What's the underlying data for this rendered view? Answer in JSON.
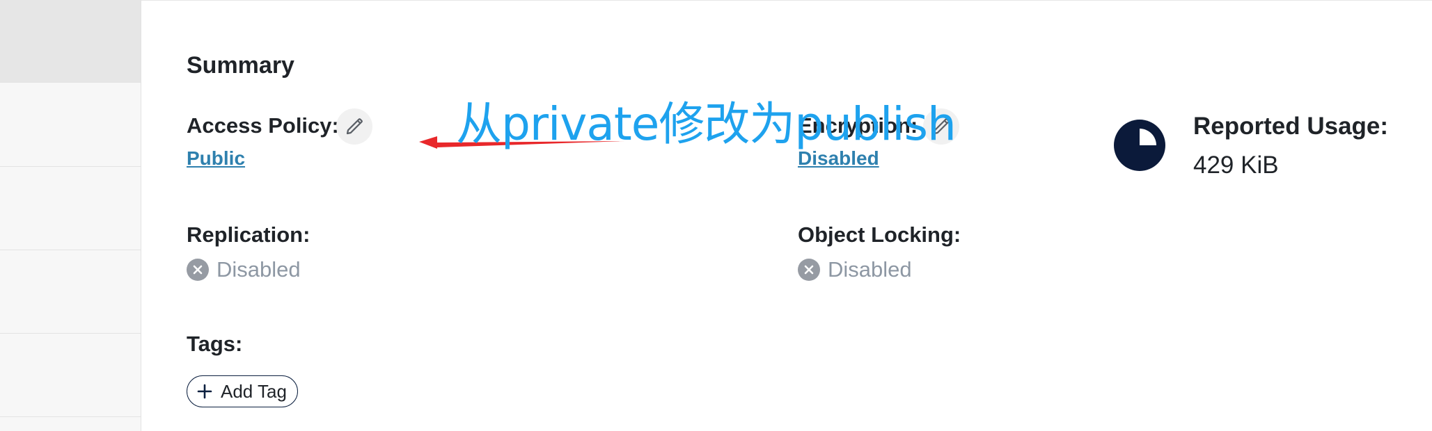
{
  "summary": {
    "title": "Summary",
    "access_policy": {
      "label": "Access Policy:",
      "value": "Public",
      "edit_icon": "pencil-icon"
    },
    "encryption": {
      "label": "Encryption:",
      "value": "Disabled",
      "edit_icon": "pencil-icon"
    },
    "reported_usage": {
      "label": "Reported Usage:",
      "value": "429 KiB",
      "icon": "pie-usage-icon"
    },
    "replication": {
      "label": "Replication:",
      "value": "Disabled",
      "icon": "x-circle-icon"
    },
    "object_locking": {
      "label": "Object Locking:",
      "value": "Disabled",
      "icon": "x-circle-icon"
    },
    "tags": {
      "label": "Tags:",
      "add_button_label": "Add Tag",
      "add_icon": "plus-icon"
    }
  },
  "annotation": {
    "text": "从private修改为publish",
    "color": "#1ea2ee",
    "arrow_color": "#e8282b"
  },
  "colors": {
    "link": "#2e80ae",
    "disabled_text": "#8d97a3",
    "usage_icon": "#0b1a3a"
  }
}
